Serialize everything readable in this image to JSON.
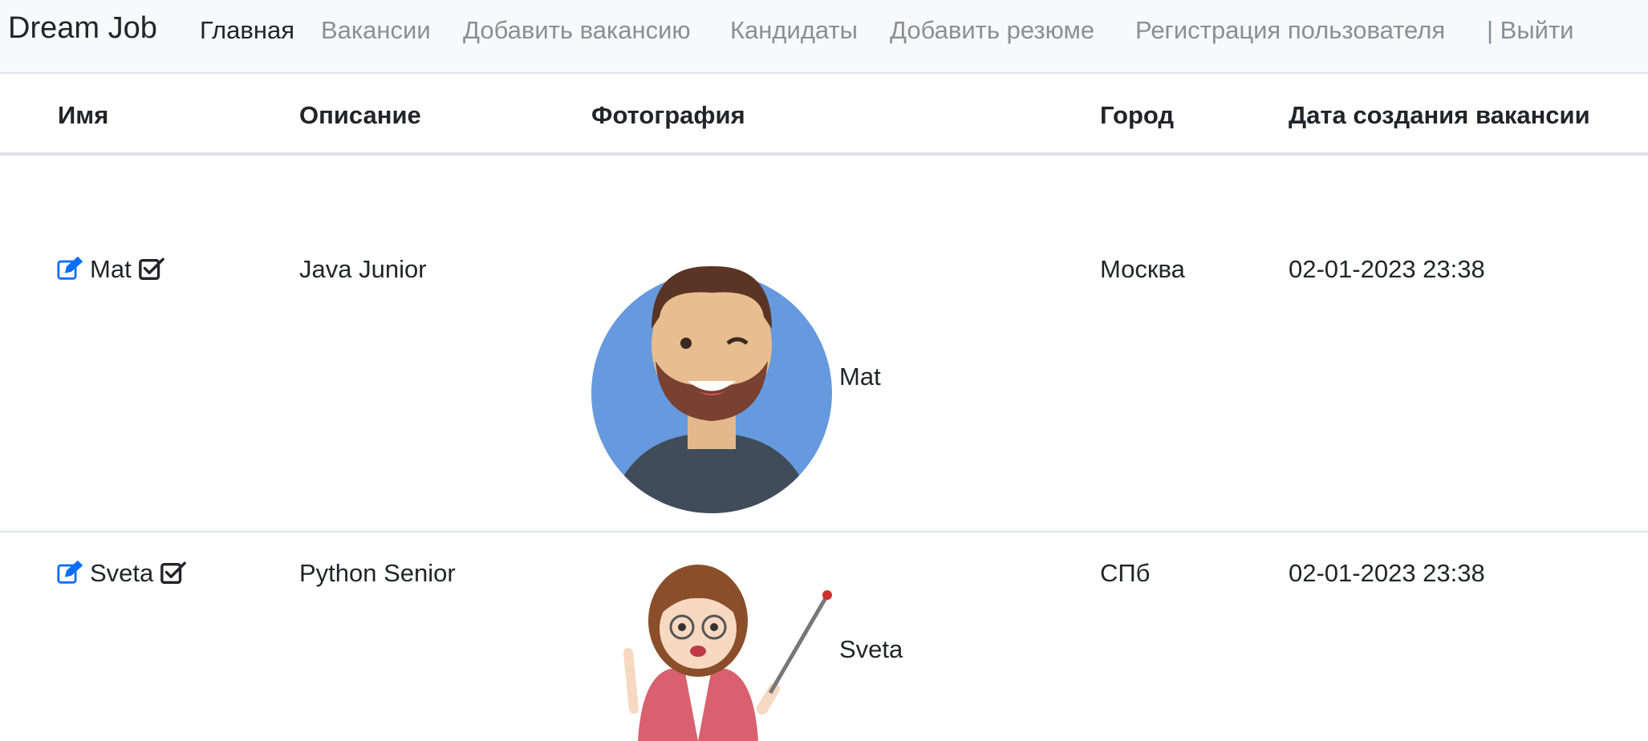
{
  "navbar": {
    "brand": "Dream Job",
    "links": [
      {
        "label": "Главная",
        "active": true
      },
      {
        "label": "Вакансии",
        "active": false
      },
      {
        "label": "Добавить вакансию",
        "active": false
      },
      {
        "label": "Кандидаты",
        "active": false
      },
      {
        "label": "Добавить резюме",
        "active": false
      },
      {
        "label": "Регистрация пользователя",
        "active": false
      },
      {
        "label": "| Выйти",
        "active": false
      }
    ]
  },
  "table": {
    "headers": {
      "name": "Имя",
      "description": "Описание",
      "photo": "Фотография",
      "city": "Город",
      "created": "Дата создания вакансии"
    },
    "rows": [
      {
        "name": "Mat",
        "description": "Java Junior",
        "photo_label": "Mat",
        "city": "Москва",
        "created": "02-01-2023 23:38"
      },
      {
        "name": "Sveta",
        "description": "Python Senior",
        "photo_label": "Sveta",
        "city": "СПб",
        "created": "02-01-2023 23:38"
      }
    ]
  },
  "icons": {
    "edit": "edit-icon",
    "check": "check-square-icon"
  },
  "colors": {
    "accent": "#0d6efd",
    "navbar_bg": "#f8f9fa",
    "muted_link": "#8a8f94"
  }
}
